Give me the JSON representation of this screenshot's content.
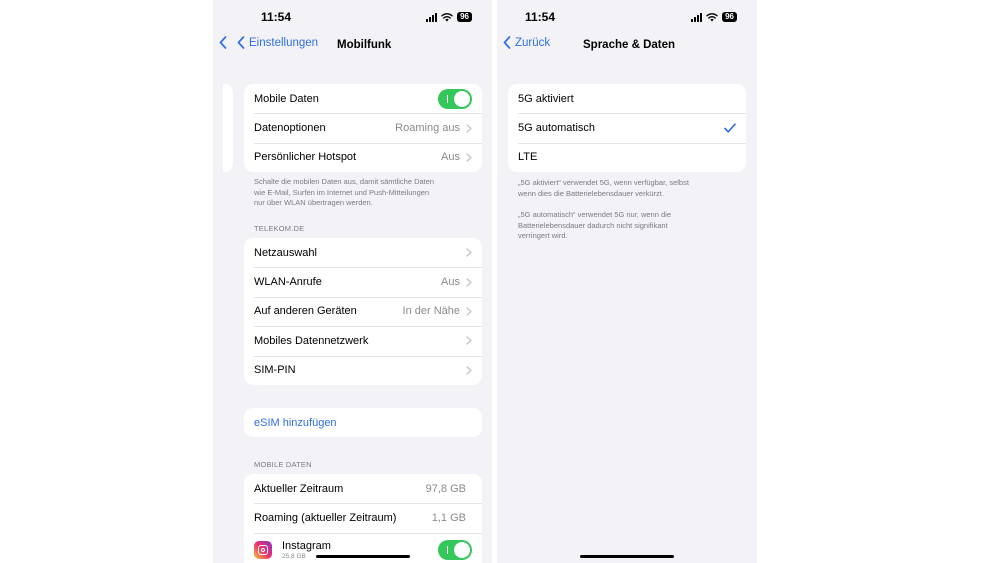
{
  "left": {
    "status": {
      "time": "11:54",
      "battery": "96"
    },
    "nav": {
      "back_label": "Einstellungen",
      "title": "Mobilfunk"
    },
    "group1": {
      "mobile_data": {
        "label": "Mobile Daten",
        "toggle_on": true
      },
      "data_options": {
        "label": "Datenoptionen",
        "value": "Roaming aus"
      },
      "hotspot": {
        "label": "Persönlicher Hotspot",
        "value": "Aus"
      }
    },
    "footnote": [
      "Schalte die mobilen Daten aus, damit sämtliche Daten",
      "wie E-Mail, Surfen im Internet und Push-Mitteilungen",
      "nur über WLAN übertragen werden."
    ],
    "carrier_header": "TELEKOM.DE",
    "carrier_rows": [
      {
        "label": "Netzauswahl",
        "value": ""
      },
      {
        "label": "WLAN-Anrufe",
        "value": "Aus"
      },
      {
        "label": "Auf anderen Geräten",
        "value": "In der Nähe"
      },
      {
        "label": "Mobiles Datennetzwerk",
        "value": ""
      },
      {
        "label": "SIM-PIN",
        "value": ""
      }
    ],
    "esim_label": "eSIM hinzufügen",
    "usage_header": "MOBILE DATEN",
    "usage_rows": [
      {
        "label": "Aktueller Zeitraum",
        "value": "97,8 GB"
      },
      {
        "label": "Roaming (aktueller Zeitraum)",
        "value": "1,1 GB"
      }
    ],
    "app_row": {
      "name": "Instagram",
      "size": "25,8 GB",
      "icon": "instagram-icon",
      "toggle_on": true
    }
  },
  "right": {
    "status": {
      "time": "11:54",
      "battery": "96"
    },
    "nav": {
      "back_label": "Zurück",
      "title": "Sprache & Daten"
    },
    "options": [
      {
        "label": "5G aktiviert",
        "selected": false
      },
      {
        "label": "5G automatisch",
        "selected": true
      },
      {
        "label": "LTE",
        "selected": false
      }
    ],
    "footnotes": [
      [
        "„5G aktiviert“ verwendet 5G, wenn verfügbar, selbst",
        "wenn dies die Batterielebensdauer verkürzt."
      ],
      [
        "„5G automatisch“ verwendet 5G nur, wenn die",
        "Batterielebensdauer dadurch nicht signifikant",
        "verringert wird."
      ]
    ]
  },
  "colors": {
    "accent": "#2f6fe4",
    "toggle_on": "#34c759",
    "background": "#f2f2f7"
  }
}
